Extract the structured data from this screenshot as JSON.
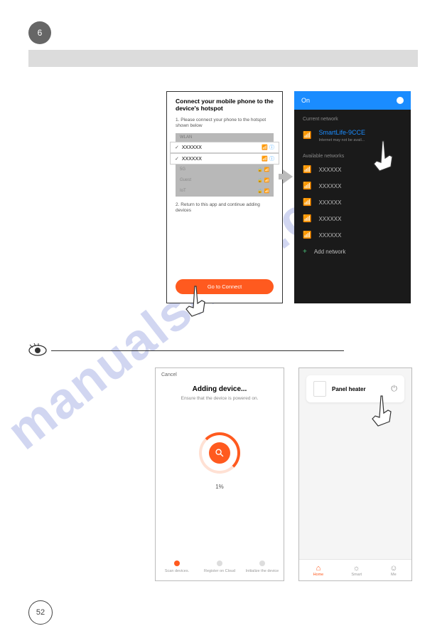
{
  "page": {
    "top_number": "6",
    "bottom_number": "52"
  },
  "watermark": "manualshive.com",
  "phone_left": {
    "title": "Connect your mobile phone to the device's hotspot",
    "step1": "1. Please connect your phone to the hotspot shown below",
    "wlan_label": "WLAN",
    "rows": {
      "r1": "XXXXXX",
      "r2": "XXXXXX"
    },
    "dim": {
      "d1": "5G",
      "d2": "Guest",
      "d3": "IoT"
    },
    "step2": "2. Return to this app and continue adding devices",
    "connect_btn": "Go to Connect"
  },
  "phone_right": {
    "on_label": "On",
    "section_current": "Current network",
    "current_name": "SmartLife-9CCE",
    "current_sub": "Internet may not be avail...",
    "section_available": "Available networks",
    "avail": {
      "a1": "XXXXXX",
      "a2": "XXXXXX",
      "a3": "XXXXXX",
      "a4": "XXXXXX",
      "a5": "XXXXXX"
    },
    "add_network": "Add network"
  },
  "phone_bl": {
    "cancel": "Cancel",
    "title": "Adding device...",
    "subtitle": "Ensure that the device is powered on.",
    "percent": "1%",
    "steps": {
      "s1": "Scan devices.",
      "s2": "Register on Cloud",
      "s3": "Initialize the device"
    }
  },
  "phone_br": {
    "device_name": "Panel heater",
    "tabs": {
      "home": "Home",
      "smart": "Smart",
      "me": "Me"
    }
  }
}
